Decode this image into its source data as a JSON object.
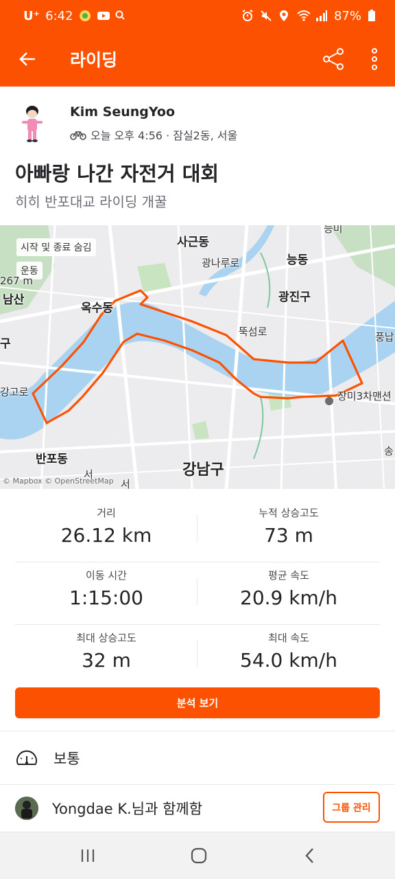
{
  "status_bar": {
    "carrier": "U⁺",
    "time": "6:42",
    "battery": "87%"
  },
  "app_bar": {
    "title": "라이딩"
  },
  "activity": {
    "athlete_name": "Kim SeungYoo",
    "meta": "오늘 오후 4:56 · 잠실2동, 서울",
    "title": "아빠랑 나간 자전거 대회",
    "description": "히히 반포대교 라이딩 개꿀"
  },
  "map": {
    "toggle_start_end": "시작 및 종료 숨김",
    "poi": "운동",
    "elevation": "267 m",
    "labels": {
      "sageun": "사근동",
      "neung": "능동",
      "gwangnaru": "광나루로",
      "gwangjin": "광진구",
      "oksu": "옥수동",
      "ttukseom": "뚝섬로",
      "pungnap": "풍납",
      "namsan": "남산",
      "gu": "구",
      "gogoro": "강고로",
      "jangmi": "장미3차맨션",
      "banpo": "반포동",
      "gangnam": "강남구",
      "seo1": "서",
      "seo2": "서",
      "song": "송",
      "attribution": "© Mapbox © OpenStreetMap",
      "top": "능미"
    }
  },
  "stats": [
    {
      "left": {
        "label": "거리",
        "value": "26.12 km"
      },
      "right": {
        "label": "누적 상승고도",
        "value": "73 m"
      }
    },
    {
      "left": {
        "label": "이동 시간",
        "value": "1:15:00"
      },
      "right": {
        "label": "평균 속도",
        "value": "20.9 km/h"
      }
    },
    {
      "left": {
        "label": "최대 상승고도",
        "value": "32 m"
      },
      "right": {
        "label": "최대 속도",
        "value": "54.0 km/h"
      }
    }
  ],
  "buttons": {
    "analysis": "분석 보기",
    "group_manage": "그룹 관리"
  },
  "effort": {
    "label": "보통",
    "icon": "gauge-icon"
  },
  "group": {
    "text": "Yongdae K.님과 함께함"
  },
  "colors": {
    "brand": "#fc5200",
    "route": "#fc5200",
    "water": "#a9d3f0"
  }
}
